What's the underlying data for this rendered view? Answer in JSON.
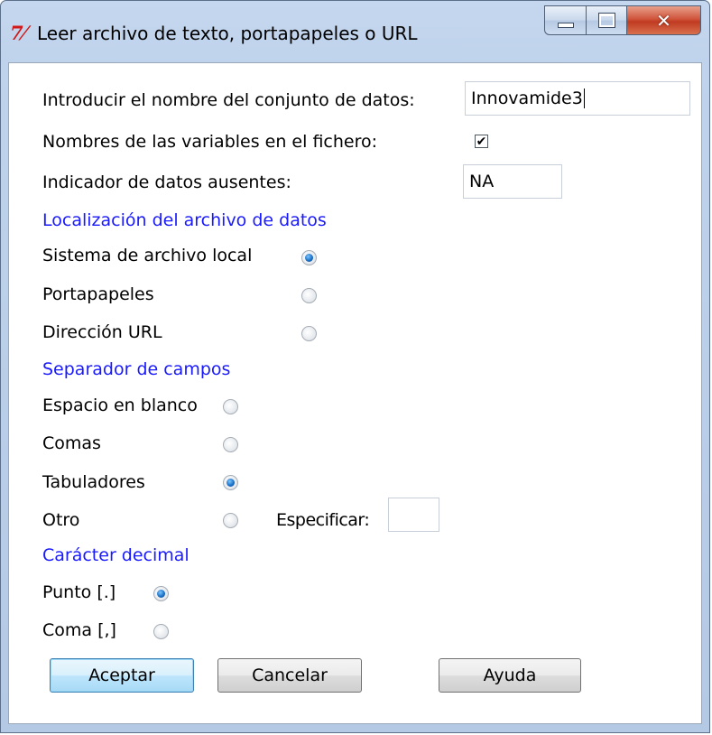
{
  "window": {
    "title": "Leer archivo de texto, portapapeles o URL",
    "icon": "tk-feather-icon",
    "controls": {
      "minimize": "minimize-icon",
      "maximize": "maximize-icon",
      "close": "close-icon"
    }
  },
  "form": {
    "dataset_label": "Introducir el nombre del conjunto de datos:",
    "dataset_value": "Innovamide3",
    "varnames_label": "Nombres de las variables en el fichero:",
    "varnames_checked": true,
    "varnames_mark": "✔",
    "missing_label": "Indicador de datos ausentes:",
    "missing_value": "NA"
  },
  "location": {
    "title": "Localización del archivo de datos",
    "options": [
      {
        "label": "Sistema de archivo local",
        "selected": true
      },
      {
        "label": "Portapapeles",
        "selected": false
      },
      {
        "label": "Dirección URL",
        "selected": false
      }
    ]
  },
  "separator": {
    "title": "Separador de campos",
    "options": [
      {
        "label": "Espacio en blanco",
        "selected": false
      },
      {
        "label": "Comas",
        "selected": false
      },
      {
        "label": "Tabuladores",
        "selected": true
      },
      {
        "label": "Otro",
        "selected": false
      }
    ],
    "specify_label": "Especificar:",
    "specify_value": ""
  },
  "decimal": {
    "title": "Carácter decimal",
    "options": [
      {
        "label": "Punto [.]",
        "selected": true
      },
      {
        "label": "Coma [,]",
        "selected": false
      }
    ]
  },
  "buttons": {
    "ok": "Aceptar",
    "cancel": "Cancelar",
    "help": "Ayuda"
  },
  "colors": {
    "section_title": "#1a1aff",
    "radio_selected": "#1c72c8",
    "close_button": "#c03a20"
  }
}
